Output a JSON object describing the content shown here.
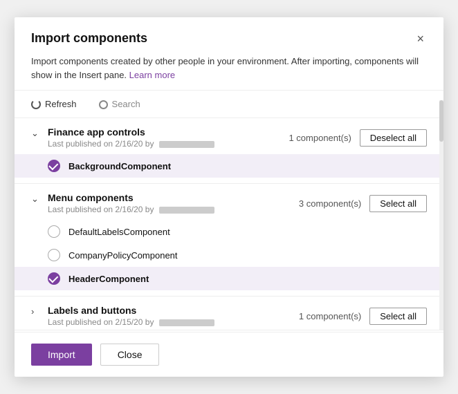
{
  "dialog": {
    "title": "Import components",
    "close_label": "×",
    "description": "Import components created by other people in your environment. After importing, components will show in the Insert pane.",
    "learn_more_label": "Learn more"
  },
  "toolbar": {
    "refresh_label": "Refresh",
    "search_placeholder": "Search"
  },
  "groups": [
    {
      "id": "finance",
      "name": "Finance app controls",
      "meta_prefix": "Last published on 2/16/20 by",
      "expanded": true,
      "component_count": "1 component(s)",
      "action_label": "Deselect all",
      "components": [
        {
          "id": "bg",
          "name": "BackgroundComponent",
          "selected": true
        }
      ]
    },
    {
      "id": "menu",
      "name": "Menu components",
      "meta_prefix": "Last published on 2/16/20 by",
      "expanded": true,
      "component_count": "3 component(s)",
      "action_label": "Select all",
      "components": [
        {
          "id": "dl",
          "name": "DefaultLabelsComponent",
          "selected": false
        },
        {
          "id": "cp",
          "name": "CompanyPolicyComponent",
          "selected": false
        },
        {
          "id": "hc",
          "name": "HeaderComponent",
          "selected": true
        }
      ]
    },
    {
      "id": "labels",
      "name": "Labels and buttons",
      "meta_prefix": "Last published on 2/15/20 by",
      "expanded": false,
      "component_count": "1 component(s)",
      "action_label": "Select all",
      "components": []
    }
  ],
  "footer": {
    "import_label": "Import",
    "close_label": "Close"
  }
}
